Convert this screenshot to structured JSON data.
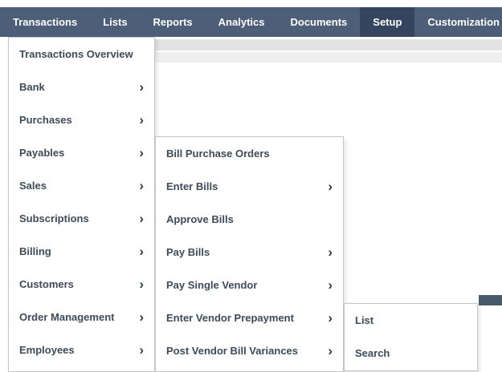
{
  "navbar": {
    "items": [
      {
        "label": "Transactions",
        "active": false
      },
      {
        "label": "Lists",
        "active": false
      },
      {
        "label": "Reports",
        "active": false
      },
      {
        "label": "Analytics",
        "active": false
      },
      {
        "label": "Documents",
        "active": false
      },
      {
        "label": "Setup",
        "active": true
      },
      {
        "label": "Customization",
        "active": false
      }
    ]
  },
  "menus": {
    "level1": {
      "items": [
        {
          "label": "Transactions Overview",
          "has_submenu": false
        },
        {
          "label": "Bank",
          "has_submenu": true
        },
        {
          "label": "Purchases",
          "has_submenu": true
        },
        {
          "label": "Payables",
          "has_submenu": true,
          "expanded": true
        },
        {
          "label": "Sales",
          "has_submenu": true
        },
        {
          "label": "Subscriptions",
          "has_submenu": true
        },
        {
          "label": "Billing",
          "has_submenu": true
        },
        {
          "label": "Customers",
          "has_submenu": true
        },
        {
          "label": "Order Management",
          "has_submenu": true
        },
        {
          "label": "Employees",
          "has_submenu": true
        }
      ]
    },
    "level2": {
      "items": [
        {
          "label": "Bill Purchase Orders",
          "has_submenu": false
        },
        {
          "label": "Enter Bills",
          "has_submenu": true
        },
        {
          "label": "Approve Bills",
          "has_submenu": false
        },
        {
          "label": "Pay Bills",
          "has_submenu": true
        },
        {
          "label": "Pay Single Vendor",
          "has_submenu": true
        },
        {
          "label": "Enter Vendor Prepayment",
          "has_submenu": true,
          "expanded": true
        },
        {
          "label": "Post Vendor Bill Variances",
          "has_submenu": true
        }
      ]
    },
    "level3": {
      "items": [
        {
          "label": "List",
          "has_submenu": false
        },
        {
          "label": "Search",
          "has_submenu": false
        }
      ]
    }
  },
  "icons": {
    "chevron_right": "›"
  },
  "colors": {
    "navbar_bg": "#4d5e78",
    "navbar_active_bg": "#36455f",
    "menu_text": "#3d4a59",
    "menu_border": "#c6c6c6"
  }
}
